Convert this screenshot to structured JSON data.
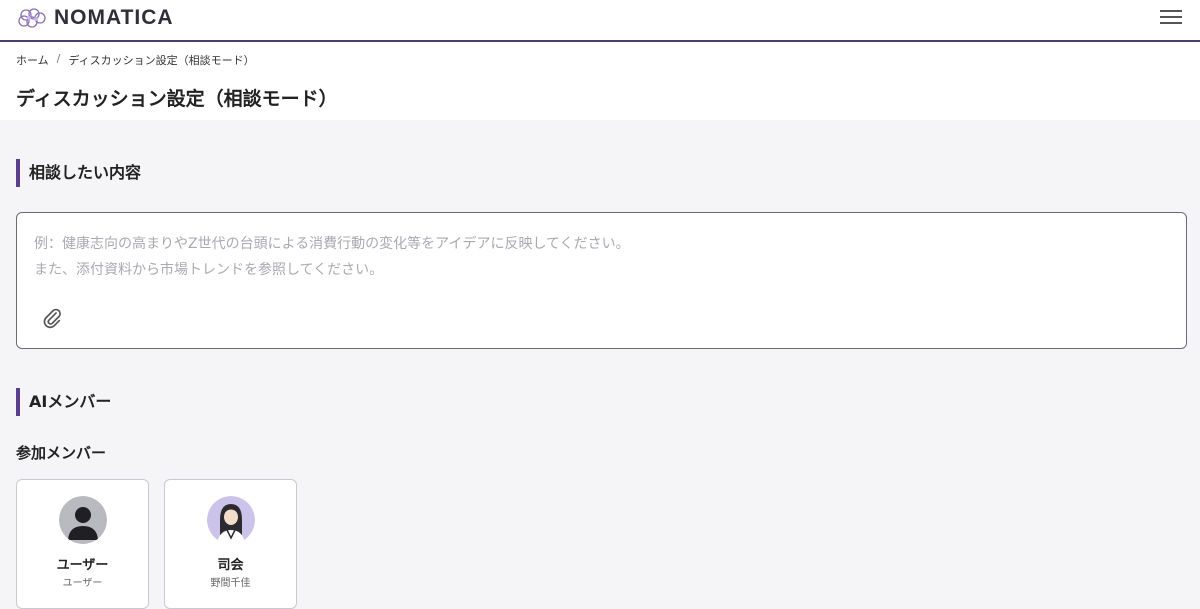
{
  "app": {
    "brand": "NOMATICA"
  },
  "header": {
    "menu_icon": "hamburger-menu-icon",
    "logo_icon": "nomatica-logo-icon"
  },
  "breadcrumb": {
    "items": [
      "ホーム",
      "ディスカッション設定（相談モード）"
    ],
    "separator": "/"
  },
  "page": {
    "title": "ディスカッション設定（相談モード）"
  },
  "consult": {
    "heading": "相談したい内容",
    "placeholder_line1": "例：健康志向の高まりやZ世代の台頭による消費行動の変化等をアイデアに反映してください。",
    "placeholder_line2": "また、添付資料から市場トレンドを参照してください。",
    "attach_icon": "paperclip-icon"
  },
  "ai_members": {
    "heading": "AIメンバー",
    "participants_label": "参加メンバー",
    "members": [
      {
        "name": "ユーザー",
        "role": "ユーザー",
        "avatar": "user-silhouette-icon"
      },
      {
        "name": "司会",
        "role": "野間千佳",
        "avatar": "moderator-avatar-icon"
      }
    ]
  },
  "colors": {
    "accent": "#5b3f8c",
    "header_border": "#4a3f66",
    "background": "#f5f4f7"
  }
}
